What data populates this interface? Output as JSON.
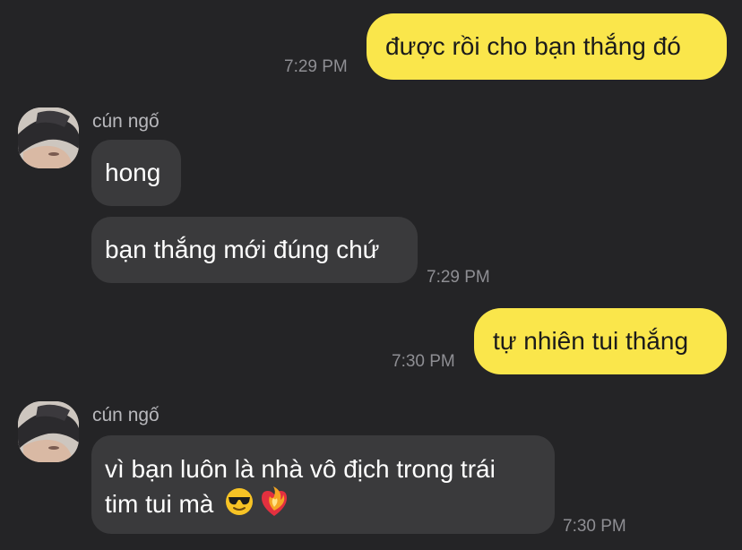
{
  "messages": [
    {
      "type": "sent",
      "text": "được rồi cho bạn thắng đó",
      "time": "7:29 PM"
    },
    {
      "type": "received",
      "sender": "cún ngố",
      "texts": [
        "hong",
        "bạn thắng mới đúng chứ"
      ],
      "time": "7:29 PM"
    },
    {
      "type": "sent",
      "text": "tự nhiên tui thắng",
      "time": "7:30 PM"
    },
    {
      "type": "received",
      "sender": "cún ngố",
      "lines": [
        "vì bạn luôn là nhà vô địch trong trái",
        "tim tui mà"
      ],
      "emojis": [
        "smiling-face-with-sunglasses",
        "heart-on-fire"
      ],
      "time": "7:30 PM"
    }
  ],
  "colors": {
    "background": "#242426",
    "sent_bubble": "#FAE64B",
    "received_bubble": "#3A3A3C",
    "timestamp": "#8E8E93"
  }
}
